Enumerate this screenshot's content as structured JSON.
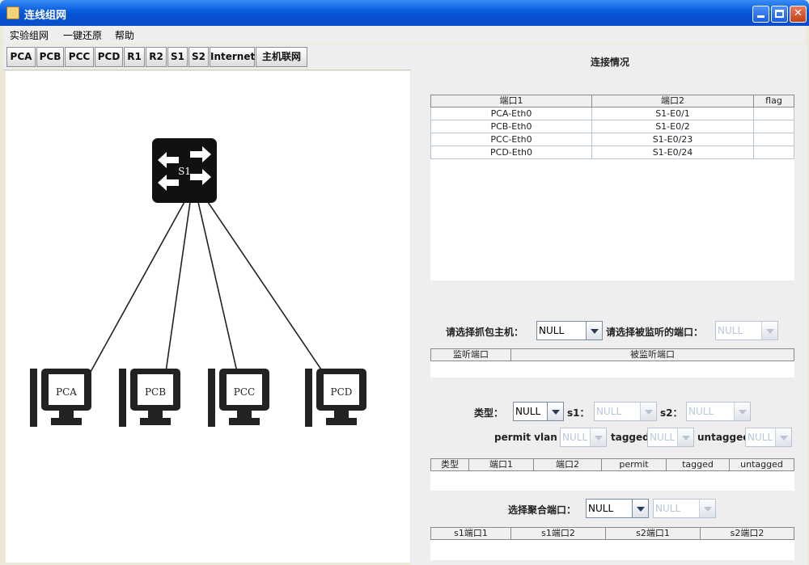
{
  "window": {
    "title": "连线组网"
  },
  "menu": [
    "实验组网",
    "一键还原",
    "帮助"
  ],
  "toolbar": [
    "PCA",
    "PCB",
    "PCC",
    "PCD",
    "R1",
    "R2",
    "S1",
    "S2",
    "Internet",
    "主机联网"
  ],
  "topology": {
    "switch": {
      "label": "S1"
    },
    "hosts": [
      "PCA",
      "PCB",
      "PCC",
      "PCD"
    ]
  },
  "connections": {
    "title": "连接情况",
    "headers": [
      "端口1",
      "端口2",
      "flag"
    ],
    "rows": [
      [
        "PCA-Eth0",
        "S1-E0/1",
        ""
      ],
      [
        "PCB-Eth0",
        "S1-E0/2",
        ""
      ],
      [
        "PCC-Eth0",
        "S1-E0/23",
        ""
      ],
      [
        "PCD-Eth0",
        "S1-E0/24",
        ""
      ]
    ]
  },
  "capture": {
    "host_label": "请选择抓包主机：",
    "host_value": "NULL",
    "port_label": "请选择被监听的端口：",
    "port_value": "NULL",
    "headers": [
      "监听端口",
      "被监听端口"
    ]
  },
  "vlan": {
    "type_label": "类型：",
    "type_value": "NULL",
    "s1_label": "s1：",
    "s1_value": "NULL",
    "s2_label": "s2：",
    "s2_value": "NULL",
    "permit_label": "permit vlan id",
    "permit_value": "NULL",
    "tagged_label": "tagged",
    "tagged_value": "NULL",
    "untagged_label": "untagged",
    "untagged_value": "NULL",
    "headers": [
      "类型",
      "端口1",
      "端口2",
      "permit",
      "tagged",
      "untagged"
    ]
  },
  "aggregation": {
    "label": "选择聚合端口：",
    "value1": "NULL",
    "value2": "NULL",
    "headers": [
      "s1端口1",
      "s1端口2",
      "s2端口1",
      "s2端口2"
    ]
  },
  "colors": {
    "titlebar": "#0a5fe0",
    "panel_bg": "#eeeeee",
    "device": "#111111"
  }
}
